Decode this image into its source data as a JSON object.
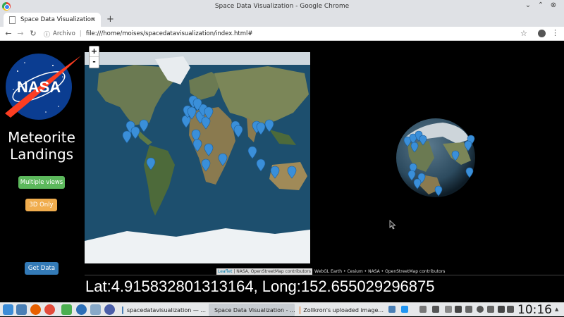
{
  "window": {
    "title": "Space Data Visualization - Google Chrome"
  },
  "tabs": [
    {
      "title": "Space Data Visualization",
      "close": "×"
    }
  ],
  "newtab_label": "+",
  "toolbar": {
    "back": "←",
    "forward": "→",
    "reload": "↻",
    "info": "ⓘ",
    "scheme_label": "Archivo",
    "url": "file:///home/moises/spacedatavisualization/index.html#",
    "star": "☆",
    "menu": "⋮"
  },
  "window_controls": {
    "minimize": "⌄",
    "maximize": "⌃",
    "close": "⊗"
  },
  "sidebar": {
    "logo_text": "NASA",
    "heading_line1": "Meteorite",
    "heading_line2": "Landings",
    "multiple_views_label": "Multiple views",
    "only3d_label": "3D Only",
    "get_data_label": "Get Data"
  },
  "map": {
    "zoom_in": "+",
    "zoom_out": "-",
    "attribution_link": "Leaflet",
    "attribution_text": " | NASA, OpenStreetMap contributors",
    "cesium_attribution": "WebGL Earth • Cesium • NASA • OpenStreetMap contributors"
  },
  "coords": {
    "lat": "4.915832801313164",
    "long": "152.655029296875",
    "label": "Lat:4.915832801313164, Long:152.655029296875"
  },
  "taskbar": {
    "tasks": [
      {
        "label": "spacedatavisualization — ...",
        "icon_color": "#4a7fb5",
        "icon": "folder-icon"
      },
      {
        "label": "Space Data Visualization - ...",
        "icon_color": "#e34b3b",
        "icon": "chrome-icon"
      },
      {
        "label": "Zollkron's uploaded image...",
        "icon_color": "#e66000",
        "icon": "firefox-icon"
      }
    ],
    "clock": "10:16"
  },
  "colors": {
    "multiple_views": "#5cb85c",
    "only3d": "#f0ad4e",
    "get_data": "#337ab7",
    "marker": "#3a8fd9"
  }
}
